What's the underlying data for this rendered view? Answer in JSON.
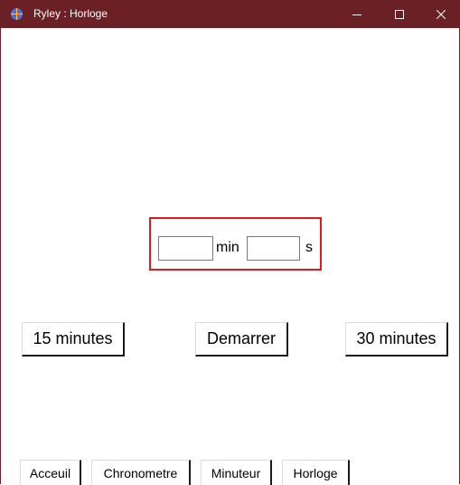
{
  "window": {
    "title": "Ryley : Horloge",
    "title_bar_color": "#6b2025",
    "app_icon": "app-logo-icon",
    "controls": {
      "minimize_icon": "minimize-icon",
      "maximize_icon": "maximize-icon",
      "close_icon": "close-icon"
    }
  },
  "timer_input": {
    "minutes_value": "",
    "minutes_unit": "min",
    "seconds_value": "",
    "seconds_unit": "s",
    "highlight_color": "#e0191e"
  },
  "actions": {
    "preset_15": "15 minutes",
    "start": "Demarrer",
    "preset_30": "30 minutes"
  },
  "nav": {
    "items": [
      {
        "label": "Acceuil"
      },
      {
        "label": "Chronometre"
      },
      {
        "label": "Minuteur"
      },
      {
        "label": "Horloge"
      }
    ]
  }
}
